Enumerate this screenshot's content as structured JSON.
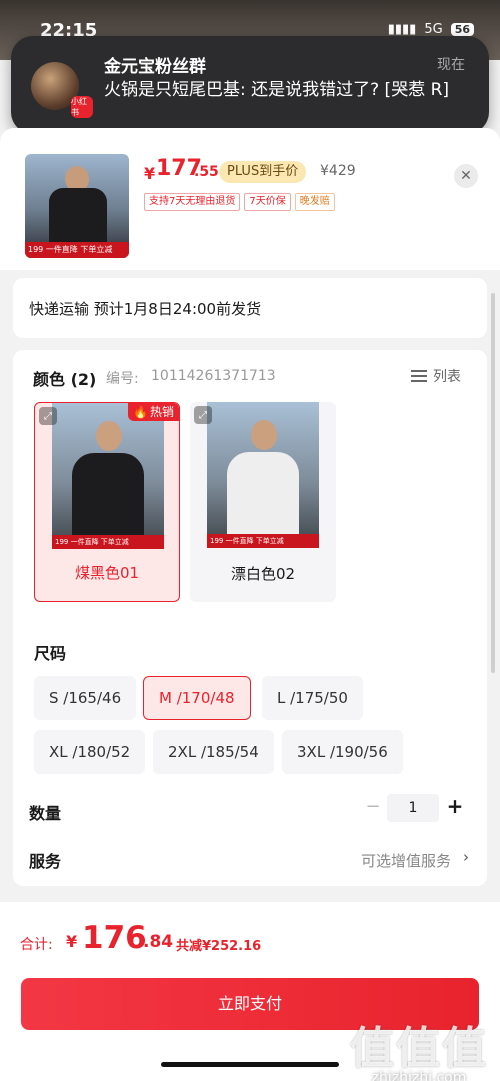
{
  "status_bar": {
    "time": "22:15",
    "network": "5G",
    "battery": "56"
  },
  "notification": {
    "title": "金元宝粉丝群",
    "time": "现在",
    "body": "火锅是只短尾巴基: 还是说我错过了? [哭惹 R]",
    "app_badge": "小红书"
  },
  "product": {
    "promo_band": "199 一件直降 下单立减",
    "price_symbol": "¥",
    "price_integer": "177",
    "price_decimal": ".55",
    "plus_label": "PLUS到手价",
    "original_price": "¥429",
    "tags": [
      "支持7天无理由退货",
      "7天价保",
      "晚发赔"
    ]
  },
  "shipping": {
    "text": "快递运输 预计1月8日24:00前发货"
  },
  "color": {
    "heading": "颜色 (2)",
    "code_label": "编号:",
    "code_value": "10114261371713",
    "list_label": "列表",
    "hot_label": "热销",
    "options": [
      {
        "name": "煤黑色01",
        "selected": true,
        "shirt_color": "#1c1c1e"
      },
      {
        "name": "漂白色02",
        "selected": false,
        "shirt_color": "#f1f1f1"
      }
    ]
  },
  "size": {
    "heading": "尺码",
    "options": [
      {
        "label": "S /165/46",
        "selected": false
      },
      {
        "label": "M /170/48",
        "selected": true
      },
      {
        "label": "L /175/50",
        "selected": false
      },
      {
        "label": "XL /180/52",
        "selected": false
      },
      {
        "label": "2XL /185/54",
        "selected": false
      },
      {
        "label": "3XL /190/56",
        "selected": false
      }
    ]
  },
  "quantity": {
    "label": "数量",
    "minus": "−",
    "value": "1",
    "plus": "+"
  },
  "service": {
    "label": "服务",
    "value": "可选增值服务",
    "arrow": "›"
  },
  "total": {
    "label": "合计:",
    "symbol": "¥",
    "integer": "176",
    "decimal": ".84",
    "savings": "共减¥252.16"
  },
  "pay_button": "立即支付",
  "watermark": {
    "logo": "值值值",
    "url": "zhizhizhi.com"
  },
  "colors": {
    "accent": "#e8232d",
    "plus_bg": "#fbe7b2"
  }
}
